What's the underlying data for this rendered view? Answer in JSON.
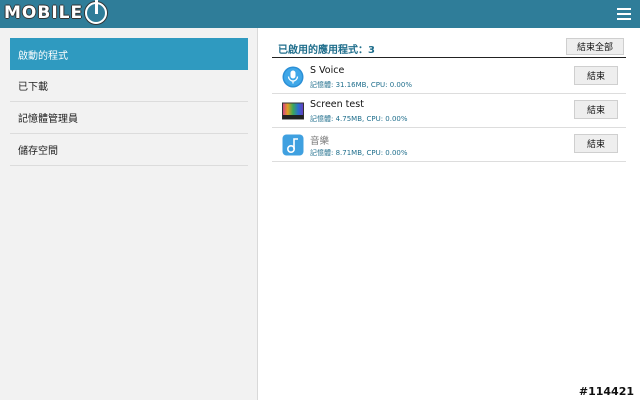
{
  "header": {
    "logo_text": "MOBILE",
    "menu_icon": "hamburger-menu-icon"
  },
  "sidebar": {
    "items": [
      {
        "label": "啟動的程式",
        "active": true
      },
      {
        "label": "已下載",
        "active": false
      },
      {
        "label": "記憶體管理員",
        "active": false
      },
      {
        "label": "儲存空間",
        "active": false
      }
    ]
  },
  "main": {
    "title": "已啟用的應用程式：3",
    "end_all_label": "結束全部",
    "apps": [
      {
        "name": "S Voice",
        "stats": "記憶體: 31.16MB, CPU: 0.00%",
        "end_label": "結束",
        "icon": "microphone-icon",
        "dimmed": false
      },
      {
        "name": "Screen test",
        "stats": "記憶體: 4.75MB, CPU: 0.00%",
        "end_label": "結束",
        "icon": "color-bars-icon",
        "dimmed": false
      },
      {
        "name": "音樂",
        "stats": "記憶體: 8.71MB, CPU: 0.00%",
        "end_label": "結束",
        "icon": "music-note-icon",
        "dimmed": true
      }
    ]
  },
  "watermark": "#114421",
  "colors": {
    "topbar": "#2f7d99",
    "accent": "#2f9ac0",
    "title_text": "#1f6e8c"
  }
}
